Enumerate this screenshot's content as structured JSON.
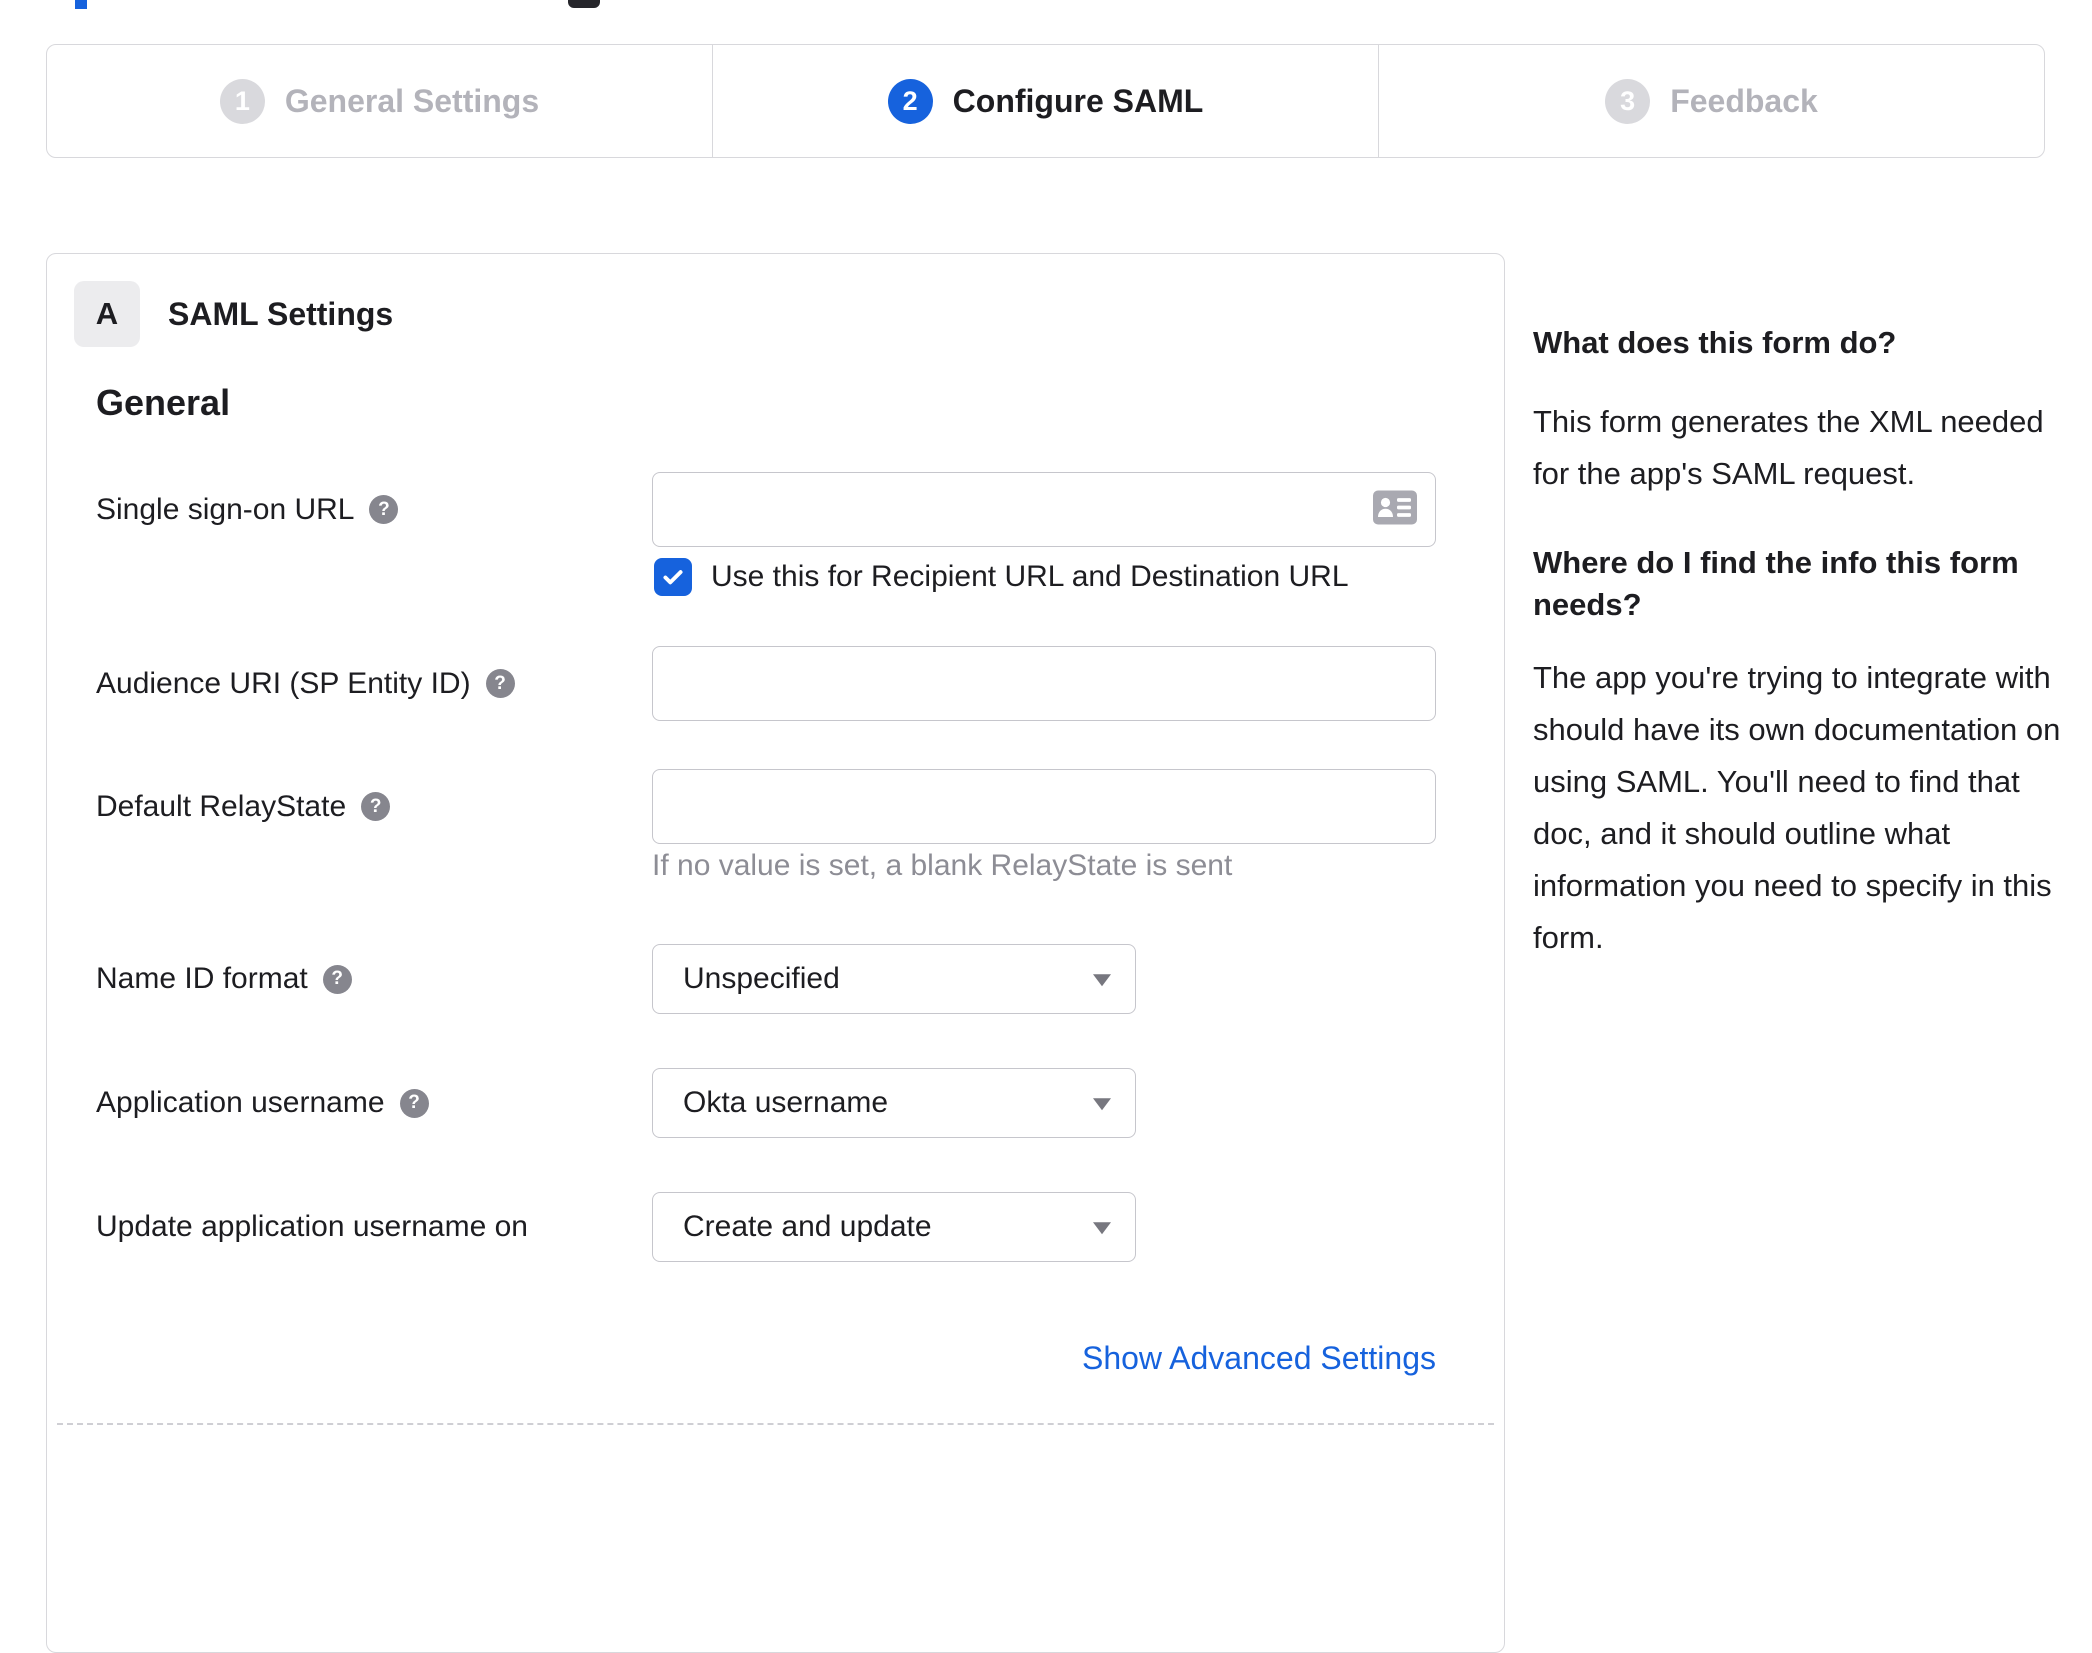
{
  "colors": {
    "accent_blue": "#1662dd",
    "link_blue": "#1662dd",
    "border_gray": "#d8d8dc",
    "inactive_gray": "#b3b3ba",
    "hint_gray": "#8d8d95"
  },
  "icons": {
    "help_glyph": "?",
    "contact_card": "contact-card",
    "caret": "caret-down"
  },
  "stepper": {
    "steps": [
      {
        "number": "1",
        "label": "General Settings",
        "state": "inactive"
      },
      {
        "number": "2",
        "label": "Configure SAML",
        "state": "active"
      },
      {
        "number": "3",
        "label": "Feedback",
        "state": "inactive"
      }
    ]
  },
  "panel": {
    "badge": "A",
    "title": "SAML Settings",
    "section_title": "General"
  },
  "form": {
    "sso": {
      "label": "Single sign-on URL",
      "value": "",
      "checkbox_label": "Use this for Recipient URL and Destination URL",
      "checked": true
    },
    "audience": {
      "label": "Audience URI (SP Entity ID)",
      "value": ""
    },
    "relaystate": {
      "label": "Default RelayState",
      "value": "",
      "hint": "If no value is set, a blank RelayState is sent"
    },
    "nameid": {
      "label": "Name ID format",
      "value": "Unspecified"
    },
    "appusername": {
      "label": "Application username",
      "value": "Okta username"
    },
    "updateusername": {
      "label": "Update application username on",
      "value": "Create and update"
    },
    "advanced_link": "Show Advanced Settings"
  },
  "sidebar": {
    "q1": "What does this form do?",
    "a1": "This form generates the XML needed for the app's SAML request.",
    "q2": "Where do I find the info this form needs?",
    "a2": "The app you're trying to integrate with should have its own documentation on using SAML. You'll need to find that doc, and it should outline what information you need to specify in this form."
  }
}
